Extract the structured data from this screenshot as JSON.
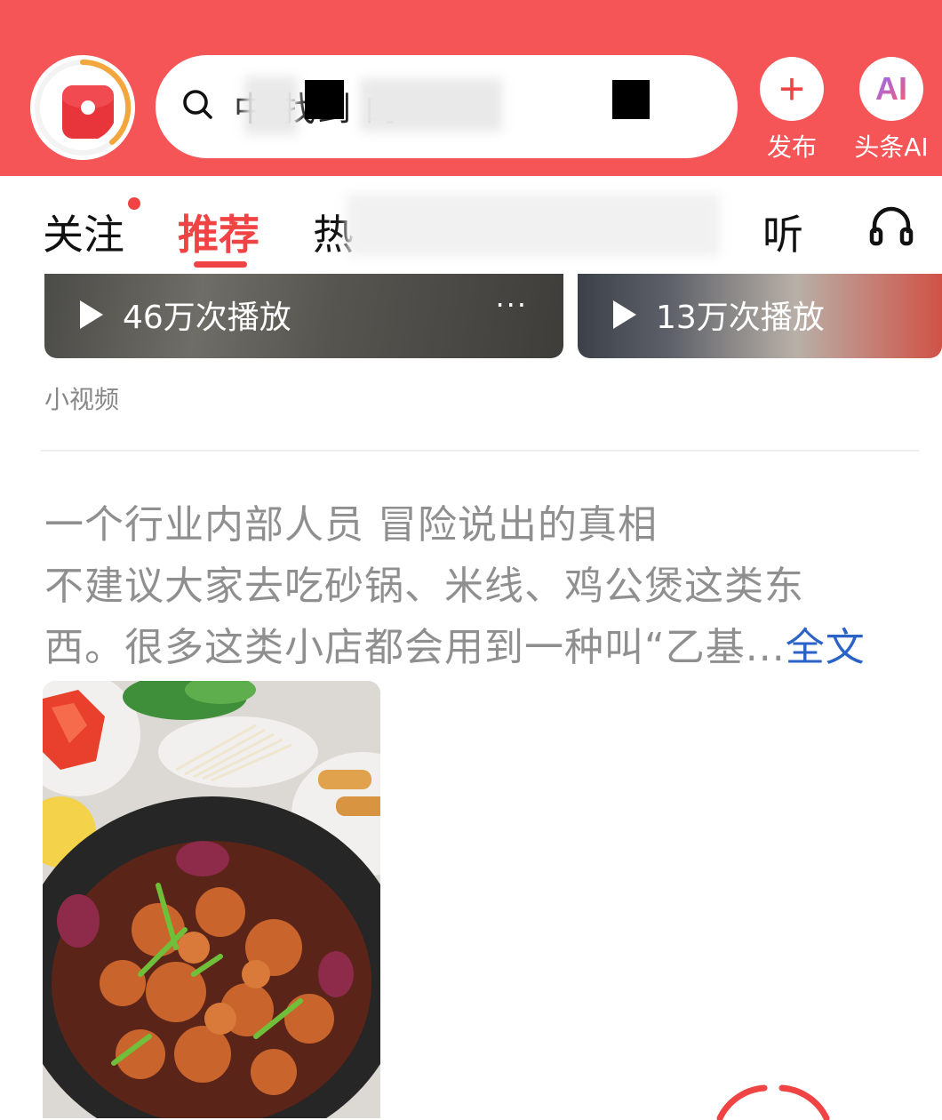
{
  "header": {
    "search": {
      "text_visible": "中 找到 的"
    },
    "actions": [
      {
        "label": "发布",
        "icon": "plus-icon"
      },
      {
        "label": "头条AI",
        "icon_text": "AI"
      }
    ],
    "colors": {
      "brand": "#f55556",
      "accent": "#f04343"
    }
  },
  "tabs": {
    "items": [
      {
        "label": "关注"
      },
      {
        "label": "推荐"
      },
      {
        "label": "热"
      },
      {
        "label": "听"
      }
    ],
    "active": "推荐"
  },
  "video_cards": [
    {
      "play_count": "46万次播放",
      "more": "···"
    },
    {
      "play_count": "13万次播放"
    }
  ],
  "section_label": "小视频",
  "article": {
    "lines": [
      "一个行业内部人员 冒险说出的真相",
      "不建议大家去吃砂锅、米线、鸡公煲这类东",
      "西。很多这类小店都会用到一种叫“乙基..."
    ],
    "more_link": "全文"
  }
}
